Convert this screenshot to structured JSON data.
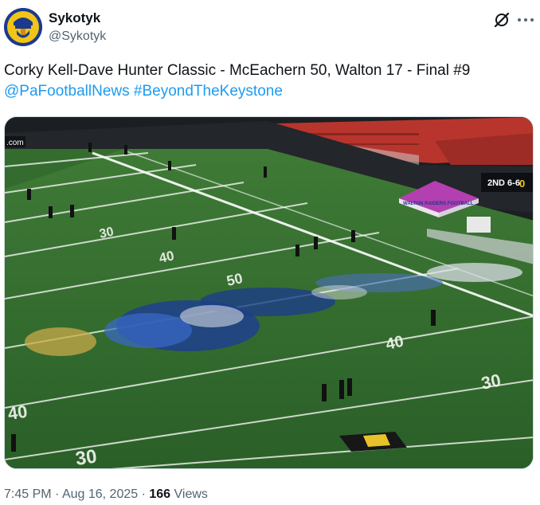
{
  "author": {
    "display_name": "Sykotyk",
    "handle": "@Sykotyk"
  },
  "tweet": {
    "text": "Corky Kell-Dave Hunter Classic - McEachern 50, Walton 17 - Final #9",
    "hashtags": [
      "@PaFootballNews",
      "#BeyondTheKeystone"
    ]
  },
  "media": {
    "scoreboard_text": "2ND 6-6",
    "scoreboard_score": "0",
    "tent_text": "WALTON RAIDERS FOOTBALL",
    "banner_text": ".com",
    "yard_numbers": [
      "30",
      "40",
      "50",
      "40",
      "30",
      "40",
      "30"
    ]
  },
  "meta": {
    "time": "7:45 PM",
    "separator": "·",
    "date": "Aug 16, 2025",
    "views_count": "166",
    "views_label": "Views"
  },
  "colors": {
    "link": "#1d9bf0",
    "field": "#2f6b2c",
    "stands": "#b8352d"
  }
}
